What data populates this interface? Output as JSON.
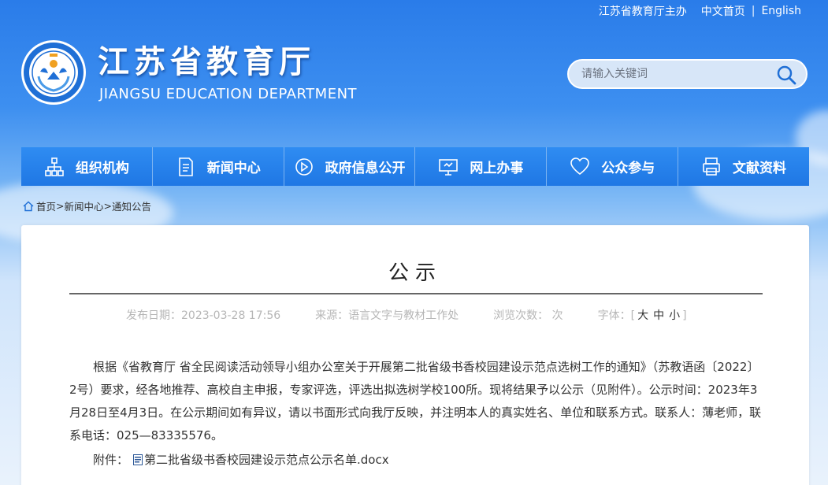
{
  "header": {
    "top_links": [
      "江苏省教育厅主办",
      "中文首页",
      "English"
    ],
    "site_title": "江苏省教育厅",
    "site_subtitle": "JIANGSU EDUCATION DEPARTMENT",
    "search_placeholder": "请输入关键词"
  },
  "nav": {
    "items": [
      {
        "label": "组织机构",
        "icon": "org-chart-icon"
      },
      {
        "label": "新闻中心",
        "icon": "document-icon"
      },
      {
        "label": "政府信息公开",
        "icon": "info-icon"
      },
      {
        "label": "网上办事",
        "icon": "monitor-icon"
      },
      {
        "label": "公众参与",
        "icon": "heart-icon"
      },
      {
        "label": "文献资料",
        "icon": "printer-icon"
      }
    ]
  },
  "breadcrumb": {
    "home": "首页",
    "sep1": ">",
    "news": "新闻中心",
    "sep2": ">",
    "current": "通知公告"
  },
  "article": {
    "title": "公示",
    "meta": {
      "date": "发布日期：2023-03-28 17:56",
      "source": "来源：语言文字与教材工作处",
      "views": "浏览次数：  次",
      "font_label": "字体：",
      "font_open": "[",
      "font_large": "大",
      "font_medium": "中",
      "font_small": "小",
      "font_close": "]"
    },
    "body": "根据《省教育厅 省全民阅读活动领导小组办公室关于开展第二批省级书香校园建设示范点选树工作的通知》（苏教语函〔2022〕2号）要求，经各地推荐、高校自主申报，专家评选，评选出拟选树学校100所。现将结果予以公示（见附件）。公示时间：2023年3月28日至4月3日。在公示期间如有异议，请以书面形式向我厅反映，并注明本人的真实姓名、单位和联系方式。联系人：薄老师，联系电话：025—83335576。",
    "attachment_label": "附件：",
    "attachment_file": "第二批省级书香校园建设示范点公示名单.docx"
  }
}
